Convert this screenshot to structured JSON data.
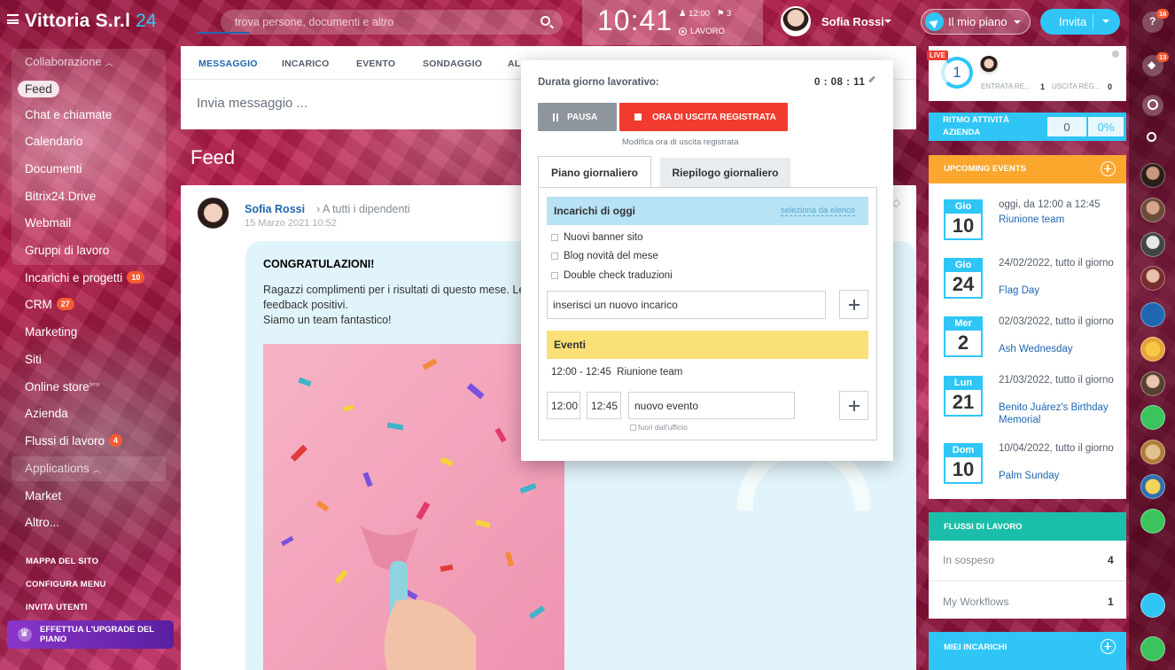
{
  "header": {
    "logo": "Vittoria S.r.l",
    "logo_number": "24",
    "search_placeholder": "trova persone, documenti e altro",
    "clock": "10:41",
    "clock_time": "12:00",
    "clock_flag_count": "3",
    "clock_status": "LAVORO",
    "user_name": "Sofia Rossi",
    "plan_label": "Il mio piano",
    "invite_label": "Invita"
  },
  "sidebar": {
    "section": "Collaborazione",
    "items": [
      {
        "label": "Feed"
      },
      {
        "label": "Chat e chiamate"
      },
      {
        "label": "Calendario"
      },
      {
        "label": "Documenti"
      },
      {
        "label": "Bitrix24.Drive"
      },
      {
        "label": "Webmail"
      },
      {
        "label": "Gruppi di lavoro"
      },
      {
        "label": "Incarichi e progetti",
        "badge": "10"
      },
      {
        "label": "CRM",
        "badge": "27"
      },
      {
        "label": "Marketing"
      },
      {
        "label": "Siti"
      },
      {
        "label": "Online store",
        "sup": "beta"
      },
      {
        "label": "Azienda"
      },
      {
        "label": "Flussi di lavoro",
        "badge": "4"
      }
    ],
    "applications": "Applications",
    "apps_items": [
      "Market",
      "Altro..."
    ],
    "links": [
      "MAPPA DEL SITO",
      "CONFIGURA MENU",
      "INVITA UTENTI"
    ],
    "upgrade": "EFFETTUA L'UPGRADE DEL PIANO"
  },
  "composer": {
    "tabs": [
      "MESSAGGIO",
      "INCARICO",
      "EVENTO",
      "SONDAGGIO",
      "AL"
    ],
    "placeholder": "Invia messaggio ..."
  },
  "feed": {
    "title": "Feed",
    "post": {
      "author": "Sofia Rossi",
      "recipient": "A tutti i dipendenti",
      "date": "15 Marzo 2021 10:52",
      "heading": "CONGRATULAZIONI!",
      "line1": "Ragazzi complimenti per i risultati di questo mese. Le v",
      "line2": "feedback positivi.",
      "line3": "Siamo un team fantastico!"
    }
  },
  "worktime": {
    "duration_label": "Durata giorno lavorativo:",
    "duration_value": "0 : 08 : 11",
    "pause_label": "PAUSA",
    "exit_label": "ORA DI USCITA REGISTRATA",
    "edit_exit": "Modifica ora di uscita registrata",
    "tab_plan": "Piano giornaliero",
    "tab_summary": "Riepilogo giornaliero",
    "tasks_title": "Incarichi di oggi",
    "tasks_select": "seleziona da elenco",
    "tasks": [
      "Nuovi banner sito",
      "Blog novità del mese",
      "Double check traduzioni"
    ],
    "new_task_placeholder": "inserisci un nuovo incarico",
    "events_title": "Eventi",
    "event_time": "12:00 - 12:45",
    "event_name": "Riunione team",
    "event_start": "12:00",
    "event_end": "12:45",
    "new_event_placeholder": "nuovo evento",
    "out_of_office": "fuori dall'ufficio"
  },
  "right": {
    "live_badge": "LIVE",
    "live_count": "1",
    "entry_label": "ENTRATA RE...",
    "entry_count": "1",
    "exit_label": "USCITA REG...",
    "exit_count": "0",
    "rhythm_label_1": "RITMO ATTIVITÀ",
    "rhythm_label_2": "AZIENDA",
    "rhythm_value": "0",
    "rhythm_percent": "0%",
    "events_title": "UPCOMING EVENTS",
    "events": [
      {
        "day": "Gio",
        "num": "10",
        "when": "oggi, da 12:00 a 12:45",
        "title": "Riunione team"
      },
      {
        "day": "Gio",
        "num": "24",
        "when": "24/02/2022, tutto il giorno",
        "title": "Flag Day"
      },
      {
        "day": "Mer",
        "num": "2",
        "when": "02/03/2022, tutto il giorno",
        "title": "Ash Wednesday"
      },
      {
        "day": "Lun",
        "num": "21",
        "when": "21/03/2022, tutto il giorno",
        "title": "Benito Juárez's Birthday Memorial"
      },
      {
        "day": "Dom",
        "num": "10",
        "when": "10/04/2022, tutto il giorno",
        "title": "Palm Sunday"
      }
    ],
    "workflows_title": "FLUSSI DI LAVORO",
    "workflows": [
      {
        "label": "In sospeso",
        "count": "4"
      },
      {
        "label": "My Workflows",
        "count": "1"
      }
    ],
    "my_tasks_title": "MIEI INCARICHI"
  },
  "rail": {
    "help_badge": "16",
    "notif_badge": "13"
  },
  "colors": {
    "accent": "#2fc6f6",
    "link": "#2067b0",
    "exit_red": "#f03b2e",
    "events_orange": "#fba62d",
    "workflow_teal": "#1bbfa9",
    "badge": "#f55a30"
  }
}
